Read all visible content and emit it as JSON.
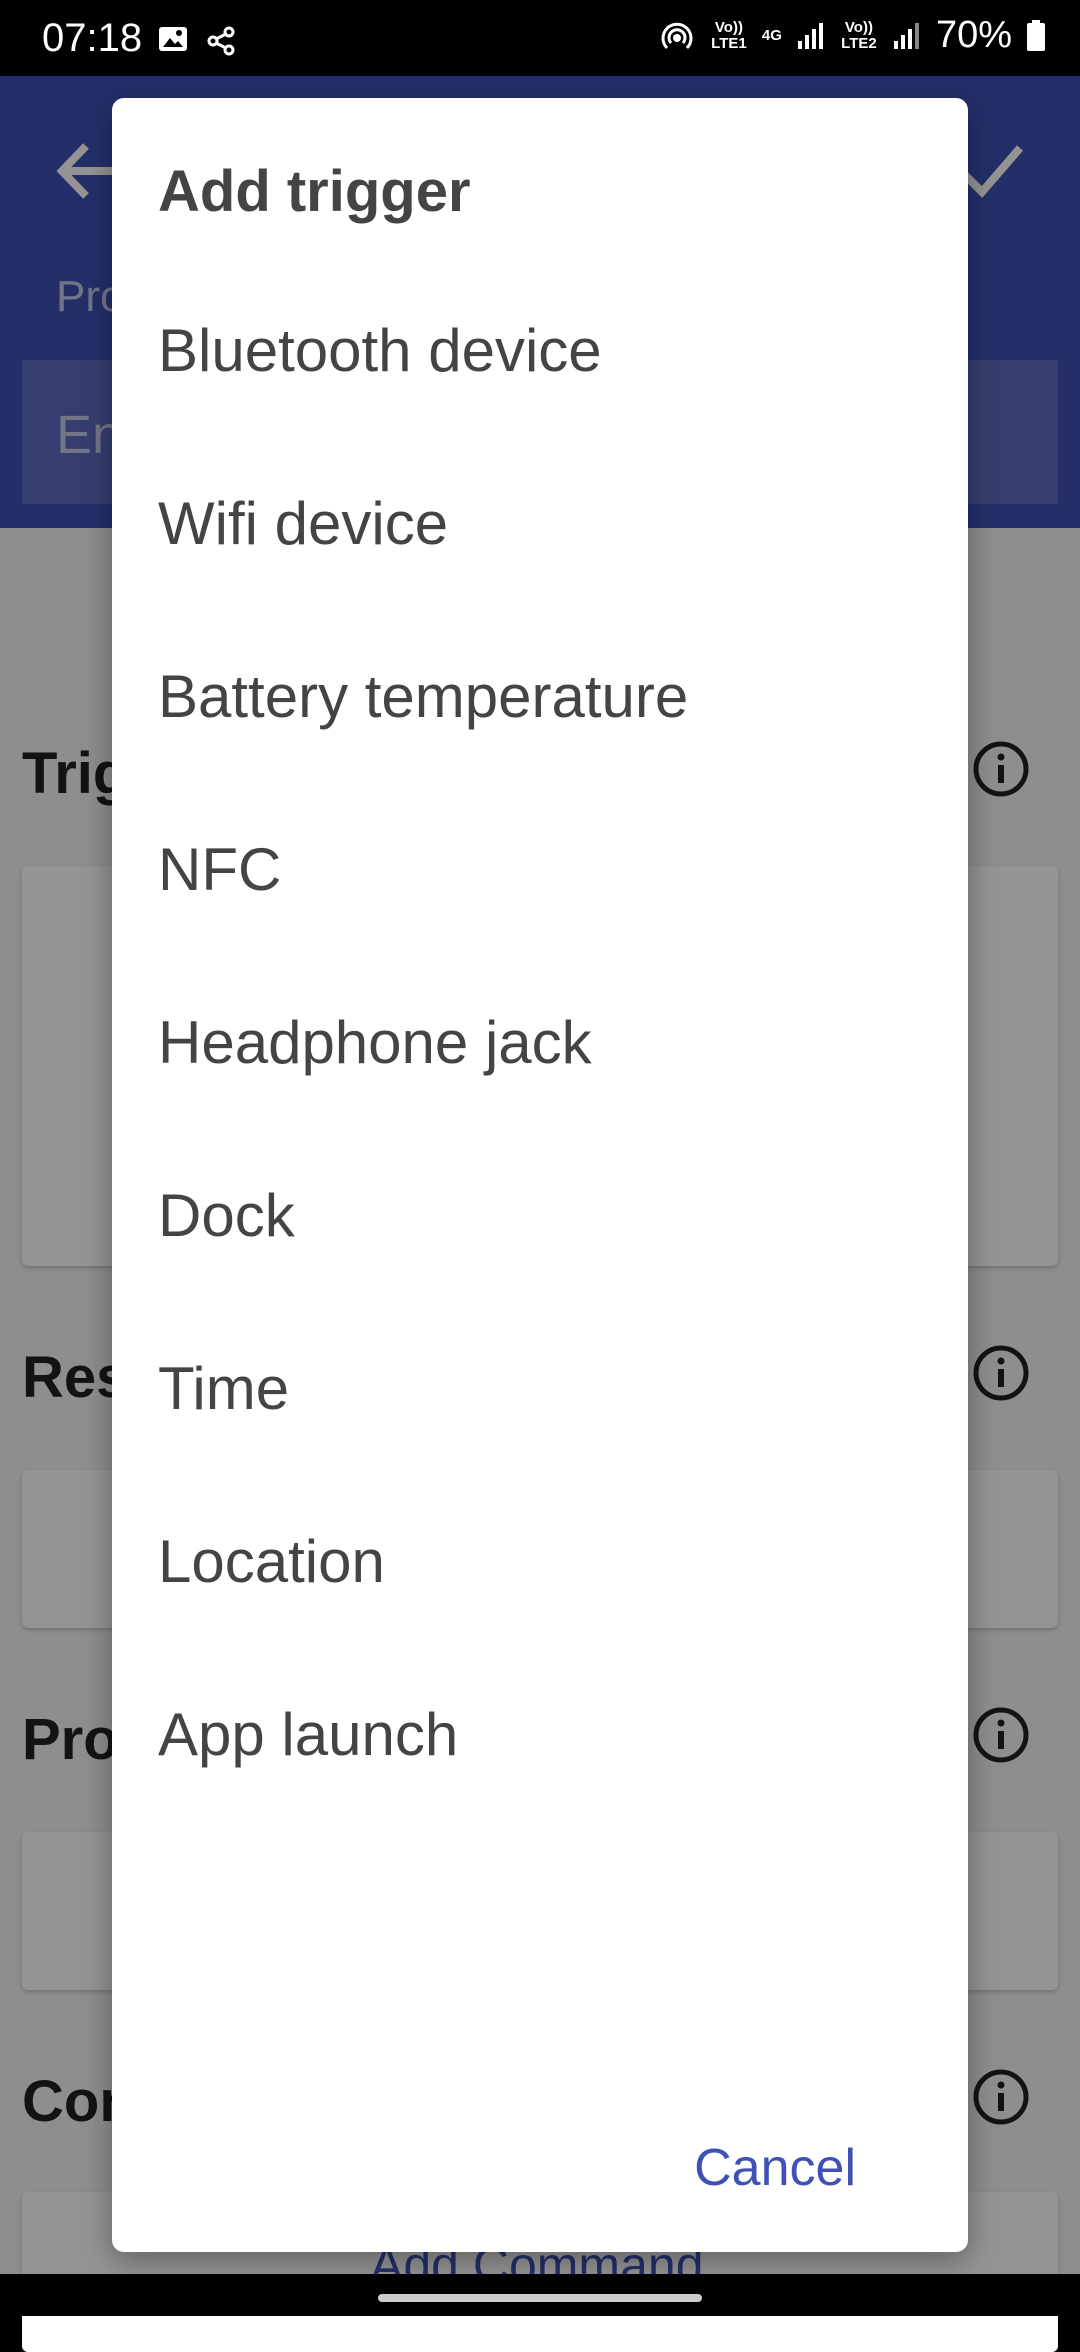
{
  "status_bar": {
    "time": "07:18",
    "left_icons": [
      "gallery-icon",
      "share-icon"
    ],
    "net1": "Vo)) LTE1",
    "net_4g": "4G",
    "net2": "Vo)) LTE2",
    "battery": "70%"
  },
  "background": {
    "profile_label": "Pro",
    "profile_placeholder": "En",
    "sections": [
      {
        "title": "Trig"
      },
      {
        "title": "Res"
      },
      {
        "title": "Pro"
      },
      {
        "title": "Con"
      }
    ],
    "add_command": "Add Command",
    "accent": "#3f51b5"
  },
  "dialog": {
    "title": "Add trigger",
    "items": [
      "Bluetooth device",
      "Wifi device",
      "Battery temperature",
      "NFC",
      "Headphone jack",
      "Dock",
      "Time",
      "Location",
      "App launch"
    ],
    "cancel": "Cancel"
  }
}
